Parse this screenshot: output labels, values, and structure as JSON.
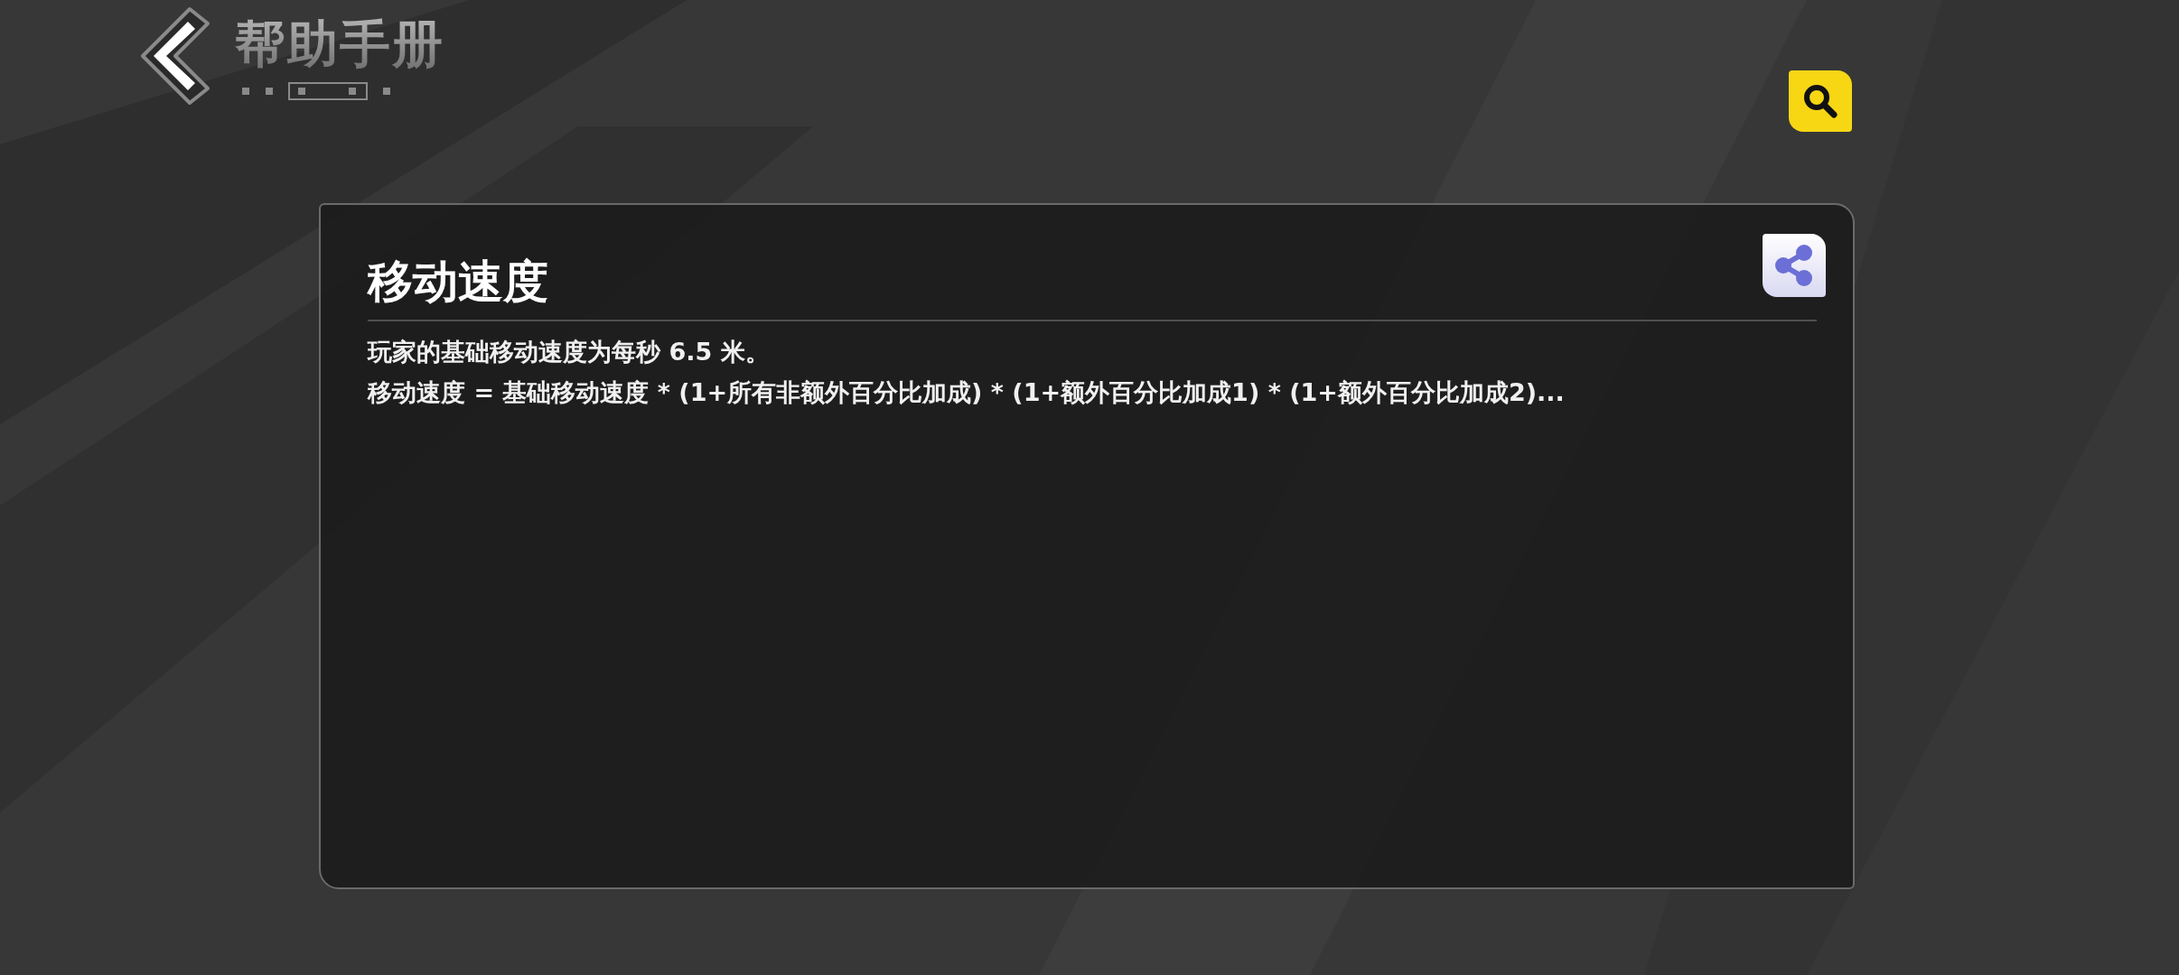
{
  "header": {
    "title": "帮助手册"
  },
  "article": {
    "title": "移动速度",
    "lines": [
      "玩家的基础移动速度为每秒 6.5 米。",
      "移动速度 = 基础移动速度 * (1+所有非额外百分比加成) * (1+额外百分比加成1) * (1+额外百分比加成2)..."
    ]
  }
}
